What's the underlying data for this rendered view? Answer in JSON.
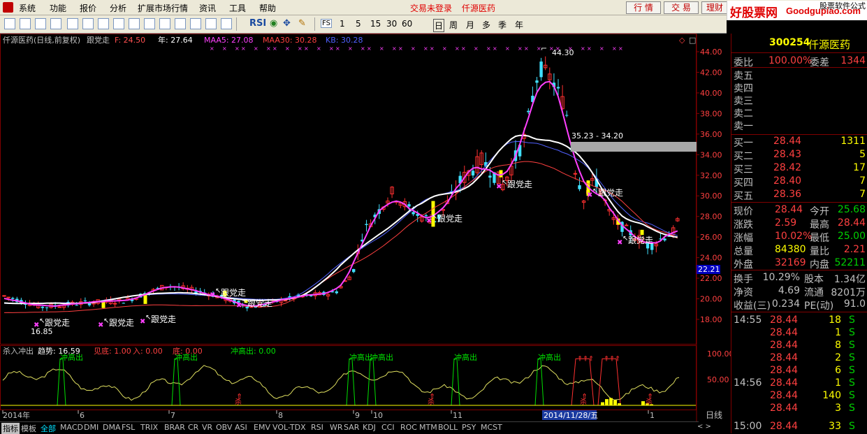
{
  "menu": {
    "items": [
      "系统",
      "功能",
      "报价",
      "分析",
      "扩展市场行情",
      "资讯",
      "工具",
      "帮助"
    ],
    "status_text": "交易未登录",
    "stock_title": "仟源医药",
    "buttons": [
      "行 情",
      "交 易",
      "理财"
    ],
    "watermark_big": "好股票网",
    "watermark_url": "Goodgupiao.com",
    "watermark_small": "股票软件公式"
  },
  "toolbar": {
    "icons": [
      "back-arrow-icon",
      "up-arrow-icon",
      "down-arrow-icon",
      "forward-icon",
      "grid-icon",
      "table-icon",
      "list-icon",
      "chart-icon",
      "bar-chart-icon",
      "kline-icon",
      "calc-icon",
      "fire-icon",
      "f10-icon",
      "fn-icon",
      "layout-icon",
      "rsi-icon",
      "move-icon",
      "pencil-icon",
      "fs-icon"
    ],
    "sym_labels": [
      "RSI"
    ],
    "periods": [
      "1",
      "5",
      "15",
      "30",
      "60",
      "日",
      "周",
      "月",
      "多",
      "季",
      "年"
    ],
    "fs_label": "FS",
    "active_period": "日"
  },
  "chart_header": {
    "name": "仟源医药(日线,前复权)",
    "indicator": "跟党走",
    "f_label": "F: 24.50",
    "year_label": "年: 27.64",
    "maa5": "MAA5: 27.08",
    "maa30": "MAA30: 30.28",
    "kb": "KB: 30.28",
    "colors": {
      "f": "#ff5050",
      "year": "#ffffff",
      "maa5": "#ff40ff",
      "maa30": "#ff4040",
      "kb": "#5060ff"
    }
  },
  "price_axis": {
    "ticks": [
      "44.00",
      "42.00",
      "40.00",
      "38.00",
      "36.00",
      "34.00",
      "32.00",
      "30.00",
      "28.00",
      "26.00",
      "24.00",
      "22.00",
      "20.00",
      "18.00"
    ],
    "current_marker": "22.21"
  },
  "annotations": {
    "high_label": "44.30",
    "low_label": "16.85",
    "range_label": "35.23 - 34.20",
    "signal_text": "跟党走",
    "signal_count": 9
  },
  "sub_header": {
    "name": "杀入冲出",
    "trend": "趋势: 16.59",
    "jiandi": "见底: 1.00",
    "ru": "入: 0.00",
    "di": "底: 0.00",
    "chonggao": "冲高出: 0.00"
  },
  "sub_axis": {
    "ticks": [
      "100.00",
      "50.00"
    ]
  },
  "sub_labels": {
    "chonggao": "冲高出",
    "sha": "杀"
  },
  "date_axis": {
    "labels": [
      "2014年",
      "6",
      "7",
      "8",
      "9",
      "10",
      "11",
      "1"
    ],
    "cursor_date": "2014/11/28/五",
    "right_label": "日线"
  },
  "bottom_tabs": [
    "指标",
    "模板",
    "全部",
    "MACD",
    "DMI",
    "DMA",
    "FSL",
    "TRIX",
    "BRAR",
    "CR",
    "VR",
    "OBV",
    "ASI",
    "EMV",
    "VOL-TDX",
    "RSI",
    "WR",
    "SAR",
    "KDJ",
    "CCI",
    "ROC",
    "MTM",
    "BOLL",
    "PSY",
    "MCST"
  ],
  "quote_panel": {
    "code": "300254",
    "name": "仟源医药",
    "weibi_label": "委比",
    "weibi_value": "100.00%",
    "weicha_label": "委差",
    "weicha_value": "1344",
    "sell_levels": [
      "卖五",
      "卖四",
      "卖三",
      "卖二",
      "卖一"
    ],
    "buy_levels": [
      {
        "label": "买一",
        "price": "28.44",
        "vol": "1311"
      },
      {
        "label": "买二",
        "price": "28.43",
        "vol": "5"
      },
      {
        "label": "买三",
        "price": "28.42",
        "vol": "17"
      },
      {
        "label": "买四",
        "price": "28.40",
        "vol": "7"
      },
      {
        "label": "买五",
        "price": "28.36",
        "vol": "7"
      }
    ],
    "stats": [
      {
        "l1": "现价",
        "v1": "28.44",
        "l2": "今开",
        "v2": "25.68",
        "c1": "#ff4040",
        "c2": "#00d000"
      },
      {
        "l1": "涨跌",
        "v1": "2.59",
        "l2": "最高",
        "v2": "28.44",
        "c1": "#ff4040",
        "c2": "#ff4040"
      },
      {
        "l1": "涨幅",
        "v1": "10.02%",
        "l2": "最低",
        "v2": "25.00",
        "c1": "#ff4040",
        "c2": "#00d000"
      },
      {
        "l1": "总量",
        "v1": "84380",
        "l2": "量比",
        "v2": "2.21",
        "c1": "#ffff00",
        "c2": "#ff4040"
      },
      {
        "l1": "外盘",
        "v1": "32169",
        "l2": "内盘",
        "v2": "52211",
        "c1": "#ff4040",
        "c2": "#00d000"
      }
    ],
    "stats2": [
      {
        "l1": "换手",
        "v1": "10.29%",
        "l2": "股本",
        "v2": "1.34亿"
      },
      {
        "l1": "净资",
        "v1": "4.69",
        "l2": "流通",
        "v2": "8201万"
      },
      {
        "l1": "收益(三)",
        "v1": "0.234",
        "l2": "PE(动)",
        "v2": "91.0"
      }
    ],
    "ticks": [
      {
        "time": "14:55",
        "price": "28.44",
        "vol": "18",
        "side": "S"
      },
      {
        "time": "",
        "price": "28.44",
        "vol": "1",
        "side": "S"
      },
      {
        "time": "",
        "price": "28.44",
        "vol": "8",
        "side": "S"
      },
      {
        "time": "",
        "price": "28.44",
        "vol": "2",
        "side": "S"
      },
      {
        "time": "",
        "price": "28.44",
        "vol": "6",
        "side": "S"
      },
      {
        "time": "14:56",
        "price": "28.44",
        "vol": "1",
        "side": "S"
      },
      {
        "time": "",
        "price": "28.44",
        "vol": "140",
        "side": "S"
      },
      {
        "time": "",
        "price": "28.44",
        "vol": "3",
        "side": "S"
      },
      {
        "time": "15:00",
        "price": "28.44",
        "vol": "33",
        "side": "S"
      }
    ]
  },
  "chart_data": {
    "type": "line",
    "title": "仟源医药(日线,前复权)",
    "x": [
      "2014-05",
      "2014-06",
      "2014-07",
      "2014-08",
      "2014-09",
      "2014-10",
      "2014-11",
      "2014-12",
      "2015-01"
    ],
    "ylim": [
      16,
      45
    ],
    "series": [
      {
        "name": "年",
        "color": "#ffffff",
        "values": [
          20.8,
          19.8,
          19.6,
          20.3,
          21.0,
          20.0,
          20.2,
          25.5,
          30.5,
          32.5,
          36.3,
          32.0,
          27.6
        ]
      },
      {
        "name": "MAA5",
        "color": "#ff40ff",
        "values": [
          19.0,
          18.8,
          19.5,
          21.3,
          20.0,
          19.5,
          21.8,
          30.5,
          28.5,
          33.5,
          41.0,
          27.5,
          27.1
        ]
      },
      {
        "name": "MAA30",
        "color": "#ff4040",
        "values": [
          19.6,
          19.2,
          19.0,
          19.8,
          20.3,
          19.7,
          20.3,
          24.5,
          28.5,
          30.8,
          35.0,
          31.0,
          29.0
        ]
      },
      {
        "name": "KB",
        "color": "#5060ff",
        "values": [
          21.0,
          20.0,
          19.8,
          20.5,
          20.4,
          20.2,
          21.6,
          28.0,
          31.0,
          33.0,
          38.5,
          33.0,
          30.3
        ]
      }
    ],
    "candles_summary": {
      "high": 44.3,
      "low": 16.85,
      "last": 28.44
    }
  }
}
